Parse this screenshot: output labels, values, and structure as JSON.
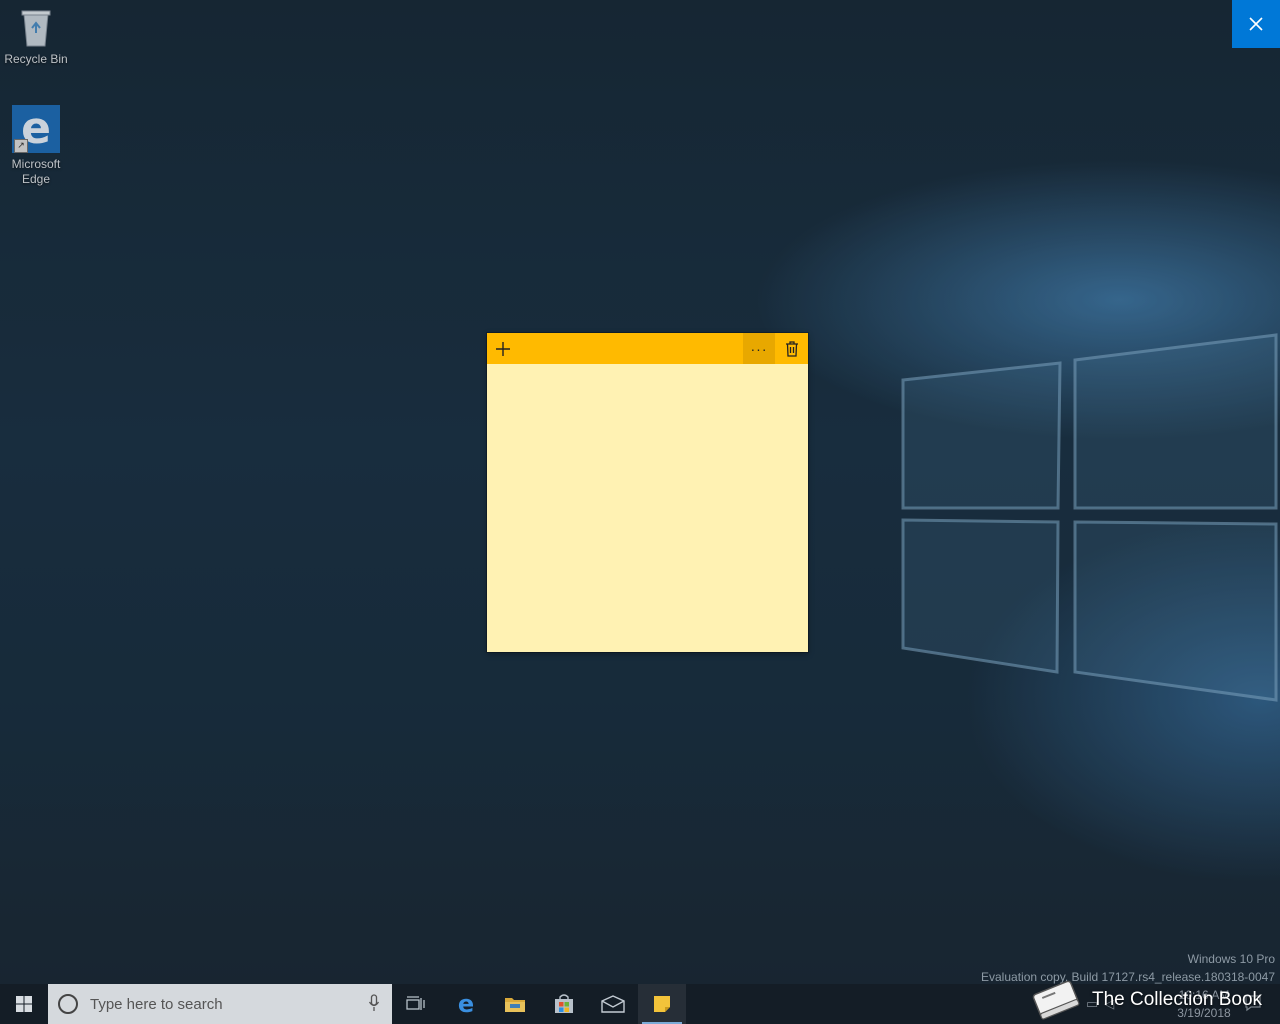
{
  "desktop": {
    "icons": [
      {
        "label": "Recycle Bin"
      },
      {
        "label": "Microsoft\nEdge"
      }
    ]
  },
  "sticky_note": {
    "menu_label": "···",
    "content": ""
  },
  "watermark": {
    "edition": "Windows 10 Pro",
    "build": "Evaluation copy. Build 17127.rs4_release.180318-0047"
  },
  "taskbar": {
    "search_placeholder": "Type here to search",
    "clock_time": "10:16 AM",
    "clock_date": "3/19/2018"
  },
  "brand": {
    "text": "The Collection Book"
  },
  "colors": {
    "sticky_header": "#ffba00",
    "sticky_body": "#fff2b3",
    "accent": "#0078d7"
  }
}
